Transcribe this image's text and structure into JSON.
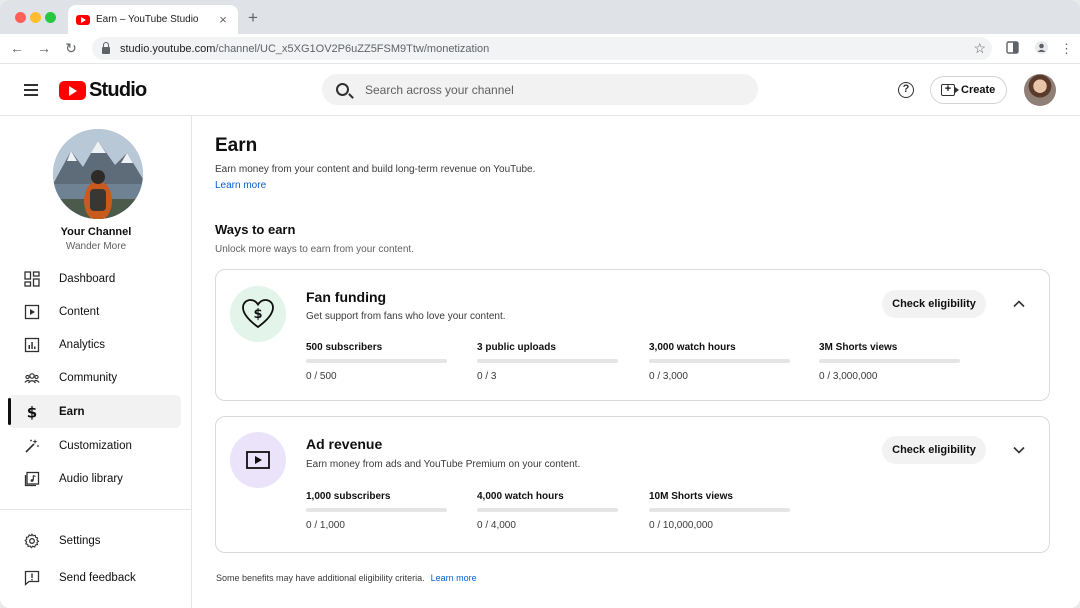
{
  "browser": {
    "tab_title": "Earn – YouTube Studio",
    "url_host": "studio.youtube.com",
    "url_path": "/channel/UC_x5XG1OV2P6uZZ5FSM9Ttw/monetization"
  },
  "header": {
    "logo_text": "Studio",
    "search_placeholder": "Search across your channel",
    "help_glyph": "?",
    "create_label": "Create"
  },
  "sidebar": {
    "channel_label": "Your Channel",
    "channel_handle": "Wander More",
    "items": [
      {
        "label": "Dashboard",
        "icon": "dashboard-icon"
      },
      {
        "label": "Content",
        "icon": "content-icon"
      },
      {
        "label": "Analytics",
        "icon": "analytics-icon"
      },
      {
        "label": "Community",
        "icon": "community-icon"
      },
      {
        "label": "Earn",
        "icon": "dollar-icon",
        "active": true
      },
      {
        "label": "Customization",
        "icon": "magic-wand-icon"
      },
      {
        "label": "Audio library",
        "icon": "audio-library-icon"
      }
    ],
    "bottom_items": [
      {
        "label": "Settings",
        "icon": "gear-icon"
      },
      {
        "label": "Send feedback",
        "icon": "feedback-icon"
      }
    ]
  },
  "main": {
    "title": "Earn",
    "description": "Earn money from your content and build long-term revenue on YouTube.",
    "learn_more": "Learn more",
    "section_title": "Ways to earn",
    "section_description": "Unlock more ways to earn from your content.",
    "cards": [
      {
        "title": "Fan funding",
        "subtitle": "Get support from fans who love your content.",
        "button": "Check eligibility",
        "expanded": true,
        "badge_color": "#e3f4ea",
        "requirements": [
          {
            "label": "500 subscribers",
            "value": "0 / 500",
            "progress": 0
          },
          {
            "label": "3 public uploads",
            "value": "0 / 3",
            "progress": 0
          },
          {
            "label": "3,000 watch hours",
            "value": "0 / 3,000",
            "progress": 0
          },
          {
            "label": "3M Shorts views",
            "value": "0 / 3,000,000",
            "progress": 0
          }
        ]
      },
      {
        "title": "Ad revenue",
        "subtitle": "Earn money from ads and YouTube Premium on your content.",
        "button": "Check eligibility",
        "expanded": false,
        "badge_color": "#ebe3fa",
        "requirements": [
          {
            "label": "1,000 subscribers",
            "value": "0 / 1,000",
            "progress": 0
          },
          {
            "label": "4,000 watch hours",
            "value": "0 / 4,000",
            "progress": 0
          },
          {
            "label": "10M Shorts views",
            "value": "0 / 10,000,000",
            "progress": 0
          }
        ]
      }
    ],
    "footnote": "Some benefits may have additional eligibility criteria.",
    "footnote_link": "Learn more"
  }
}
